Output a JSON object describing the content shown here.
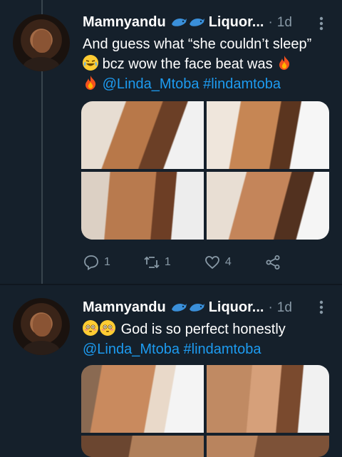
{
  "tweets": [
    {
      "author_name": "Mamnyandu",
      "author_emoji": [
        "dolphin-icon",
        "dolphin-icon"
      ],
      "author_name_suffix": "Liquor...",
      "separator": "·",
      "time": "1d",
      "text_line1": "And guess what “she couldn’t sleep”",
      "text_line2_after_emoji": "bcz wow the face beat was",
      "text_line3_mention": "@Linda_Mtoba",
      "text_line3_hashtag": "#lindamtoba",
      "emoji": [
        "face-with-tears-of-joy-emoji",
        "fire-emoji",
        "fire-emoji"
      ],
      "actions": {
        "reply_count": "1",
        "retweet_count": "1",
        "like_count": "4"
      }
    },
    {
      "author_name": "Mamnyandu",
      "author_emoji": [
        "dolphin-icon",
        "dolphin-icon"
      ],
      "author_name_suffix": "Liquor...",
      "separator": "·",
      "time": "1d",
      "text_line1_after_emoji": "God is so perfect honestly",
      "text_line2_mention": "@Linda_Mtoba",
      "text_line2_hashtag": "#lindamtoba",
      "emoji": [
        "flushed-face-emoji",
        "flushed-face-emoji"
      ]
    }
  ],
  "colors": {
    "background": "#15202b",
    "link": "#1d9bf0",
    "muted": "#8899a6"
  }
}
